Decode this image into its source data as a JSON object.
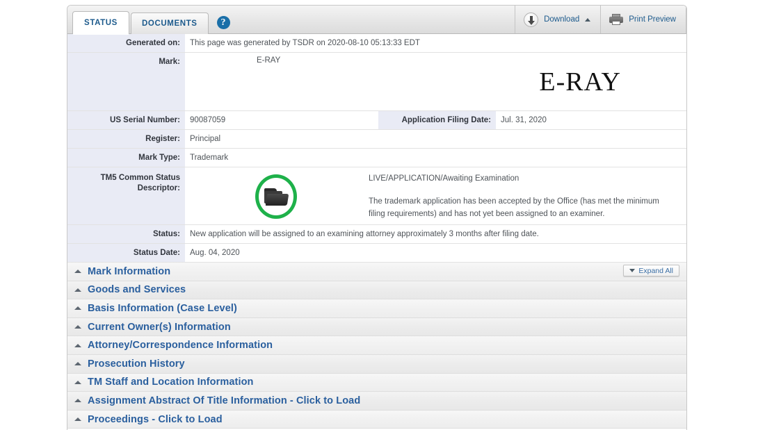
{
  "tabs": [
    {
      "label": "STATUS",
      "active": true
    },
    {
      "label": "DOCUMENTS",
      "active": false
    }
  ],
  "help_label": "?",
  "toolbar": {
    "download_label": "Download",
    "print_preview_label": "Print Preview"
  },
  "details": [
    {
      "label": "Generated on:",
      "value": "This page was generated by TSDR on 2020-08-10 05:13:33 EDT"
    },
    {
      "label": "Mark:",
      "value": "E-RAY"
    }
  ],
  "mark_image_text": "E-RAY",
  "serial_row": {
    "label": "US Serial Number:",
    "value": "90087059",
    "label2": "Application Filing Date:",
    "value2": "Jul. 31, 2020"
  },
  "register_row": {
    "label": "Register:",
    "value": "Principal"
  },
  "mark_type_row": {
    "label": "Mark Type:",
    "value": "Trademark"
  },
  "tm5": {
    "label": "TM5 Common Status Descriptor:",
    "status_line": "LIVE/APPLICATION/Awaiting Examination",
    "description": "The trademark application has been accepted by the Office (has met the minimum filing requirements) and has not yet been assigned to an examiner.",
    "icon": "green-open-folder-icon",
    "icon_color": "#1eb14a"
  },
  "status_row": {
    "label": "Status:",
    "value": "New application will be assigned to an examining attorney approximately 3 months after filing date."
  },
  "status_date_row": {
    "label": "Status Date:",
    "value": "Aug. 04, 2020"
  },
  "expand_all_label": "Expand All",
  "sections": [
    {
      "title": "Mark Information"
    },
    {
      "title": "Goods and Services"
    },
    {
      "title": "Basis Information (Case Level)"
    },
    {
      "title": "Current Owner(s) Information"
    },
    {
      "title": "Attorney/Correspondence Information"
    },
    {
      "title": "Prosecution History"
    },
    {
      "title": "TM Staff and Location Information"
    },
    {
      "title": "Assignment Abstract Of Title Information - Click to Load"
    },
    {
      "title": "Proceedings - Click to Load"
    }
  ],
  "colors": {
    "link_blue": "#2a5f9e",
    "label_bg": "#e9ebf5",
    "tab_text": "#1c5a8c",
    "status_green": "#1eb14a"
  }
}
